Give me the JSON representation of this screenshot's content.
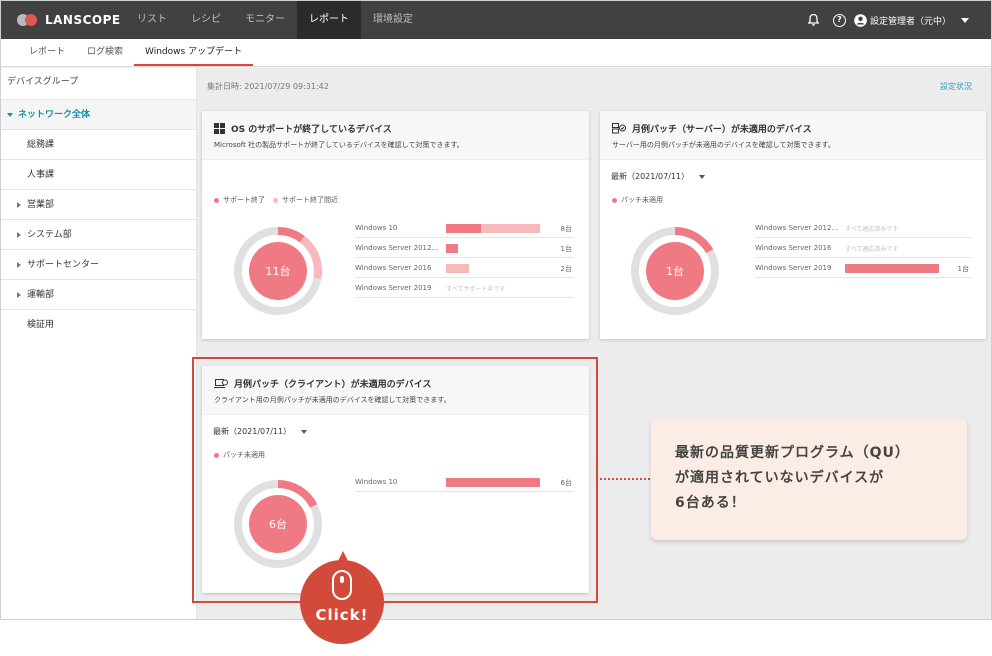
{
  "brand": "LANSCOPE",
  "topnav": {
    "items": [
      "リスト",
      "レシピ",
      "モニター",
      "レポート",
      "環境設定"
    ],
    "active_index": 3,
    "user": "設定管理者（元中）",
    "help_glyph": "?"
  },
  "subnav": {
    "items": [
      "レポート",
      "ログ検索",
      "Windows アップデート"
    ],
    "active_index": 2
  },
  "sidebar": {
    "heading": "デバイスグループ",
    "active": "ネットワーク全体",
    "items": [
      {
        "label": "総務課",
        "expandable": false
      },
      {
        "label": "人事課",
        "expandable": false
      },
      {
        "label": "営業部",
        "expandable": true
      },
      {
        "label": "システム部",
        "expandable": true
      },
      {
        "label": "サポートセンター",
        "expandable": true
      },
      {
        "label": "運輸部",
        "expandable": true
      },
      {
        "label": "検証用",
        "expandable": false
      }
    ]
  },
  "main": {
    "aggregated": "集計日時: 2021/07/29 09:31:42",
    "settings_link": "設定状況"
  },
  "cards": {
    "os": {
      "title": "OS のサポートが終了しているデバイス",
      "desc": "Microsoft 社の製品サポートが終了しているデバイスを確認して対策できます。",
      "legend": [
        "サポート終了",
        "サポート終了間近"
      ],
      "total": "11台",
      "rows": [
        {
          "label": "Windows 10",
          "count": "8台"
        },
        {
          "label": "Windows Server 2012...",
          "count": "1台"
        },
        {
          "label": "Windows Server 2016",
          "count": "2台"
        },
        {
          "label": "Windows Server 2019",
          "note": "すべてサポート中です"
        }
      ]
    },
    "server": {
      "title": "月例パッチ（サーバー）が未適用のデバイス",
      "desc": "サーバー用の月例パッチが未適用のデバイスを確認して対策できます。",
      "dropdown": "最新（2021/07/11）",
      "legend": [
        "パッチ未適用"
      ],
      "total": "1台",
      "rows": [
        {
          "label": "Windows Server 2012...",
          "note": "すべて適応済みです"
        },
        {
          "label": "Windows Server 2016",
          "note": "すべて適応済みです"
        },
        {
          "label": "Windows Server 2019",
          "count": "1台"
        }
      ]
    },
    "client": {
      "title": "月例パッチ（クライアント）が未適用のデバイス",
      "desc": "クライアント用の月例パッチが未適用のデバイスを確認して対策できます。",
      "dropdown": "最新（2021/07/11）",
      "legend": [
        "パッチ未適用"
      ],
      "total": "6台",
      "rows": [
        {
          "label": "Windows 10",
          "count": "6台"
        }
      ]
    }
  },
  "callout": {
    "lines": [
      "最新の品質更新プログラム（QU）",
      "が適用されていないデバイスが",
      "6台ある！"
    ]
  },
  "click_label": "Click!",
  "colors": {
    "accent": "#d24a3a",
    "bar_main": "#ef7a84",
    "bar_light": "#f8b9bd",
    "link": "#2aa2c0"
  }
}
